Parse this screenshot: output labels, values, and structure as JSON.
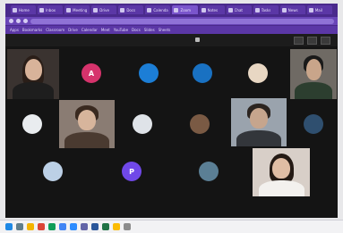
{
  "browser": {
    "tabs": [
      {
        "title": "Home",
        "active": false
      },
      {
        "title": "Inbox",
        "active": false
      },
      {
        "title": "Meeting",
        "active": false
      },
      {
        "title": "Drive",
        "active": false
      },
      {
        "title": "Docs",
        "active": false
      },
      {
        "title": "Calendar",
        "active": false
      },
      {
        "title": "Zoom",
        "active": true
      },
      {
        "title": "Notes",
        "active": false
      },
      {
        "title": "Chat",
        "active": false
      },
      {
        "title": "Tasks",
        "active": false
      },
      {
        "title": "News",
        "active": false
      },
      {
        "title": "Mail",
        "active": false
      }
    ],
    "bookmarks": [
      "Apps",
      "Bookmarks",
      "Classroom",
      "Drive",
      "Calendar",
      "Meet",
      "YouTube",
      "Docs",
      "Slides",
      "Sheets"
    ]
  },
  "meeting": {
    "info": "",
    "participants": [
      {
        "kind": "video",
        "name": "participant-1"
      },
      {
        "kind": "avatar",
        "initial": "A",
        "color": "#d6336c"
      },
      {
        "kind": "avatar",
        "initial": "",
        "color": "#1c7ed6"
      },
      {
        "kind": "avatar",
        "initial": "",
        "color": "#1971c2"
      },
      {
        "kind": "avatar",
        "initial": "",
        "color": "#e8d7c3"
      },
      {
        "kind": "video",
        "name": "participant-6"
      },
      {
        "kind": "avatar",
        "initial": "",
        "color": "#e9ecef"
      },
      {
        "kind": "video",
        "name": "participant-8"
      },
      {
        "kind": "avatar",
        "initial": "",
        "color": "#dfe3e8"
      },
      {
        "kind": "avatar",
        "initial": "",
        "color": "#7a5a44"
      },
      {
        "kind": "video",
        "name": "participant-11"
      },
      {
        "kind": "avatar",
        "initial": "",
        "color": "#2f4f6f"
      },
      {
        "kind": "avatar",
        "initial": "",
        "color": "#bcd0e6"
      },
      {
        "kind": "avatar",
        "initial": "P",
        "color": "#7048e8"
      },
      {
        "kind": "avatar",
        "initial": "",
        "color": "#5b7f95"
      },
      {
        "kind": "video",
        "name": "participant-16"
      }
    ]
  },
  "taskbar": {
    "icons": [
      {
        "name": "start-icon",
        "color": "#1e88e5"
      },
      {
        "name": "search-icon",
        "color": "#607d8b"
      },
      {
        "name": "files-icon",
        "color": "#f4b400"
      },
      {
        "name": "browser-icon",
        "color": "#db4437"
      },
      {
        "name": "mail-icon",
        "color": "#0f9d58"
      },
      {
        "name": "store-icon",
        "color": "#4285f4"
      },
      {
        "name": "zoom-icon",
        "color": "#2d8cff"
      },
      {
        "name": "teams-icon",
        "color": "#6264a7"
      },
      {
        "name": "word-icon",
        "color": "#2b579a"
      },
      {
        "name": "excel-icon",
        "color": "#217346"
      },
      {
        "name": "chrome-icon",
        "color": "#fbbc05"
      },
      {
        "name": "settings-icon",
        "color": "#8c8c8c"
      }
    ],
    "clock": ""
  }
}
